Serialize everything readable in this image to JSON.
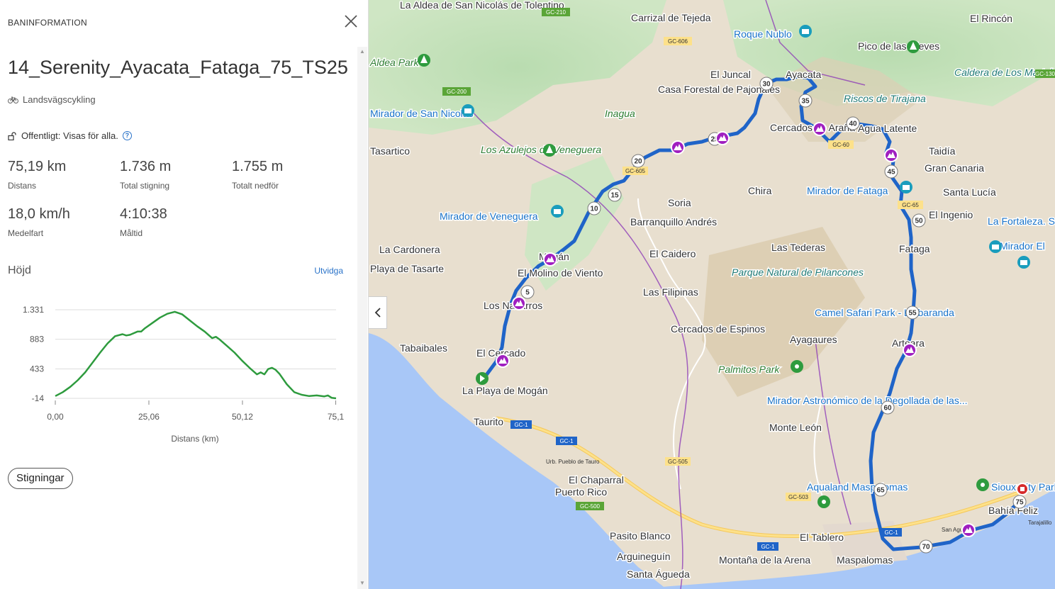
{
  "panel": {
    "header": "BANINFORMATION",
    "route_name": "14_Serenity_Ayacata_Fataga_75_TS25",
    "sport": "Landsvägscykling",
    "visibility": "Offentligt: Visas för alla.",
    "stats": [
      {
        "value": "75,19 km",
        "label": "Distans"
      },
      {
        "value": "1.736 m",
        "label": "Total stigning"
      },
      {
        "value": "1.755 m",
        "label": "Totalt nedför"
      },
      {
        "value": "18,0 km/h",
        "label": "Medelfart"
      },
      {
        "value": "4:10:38",
        "label": "Måltid"
      }
    ],
    "elevation_title": "Höjd",
    "expand_link": "Utvidga",
    "climbs_button": "Stigningar"
  },
  "chart_data": {
    "type": "line",
    "xlabel": "Distans (km)",
    "ylabel": "",
    "x_ticks": [
      "0,00",
      "25,06",
      "50,12",
      "75,1"
    ],
    "y_ticks": [
      "1.331",
      "883",
      "433",
      "-14"
    ],
    "xlim": [
      0,
      75.19
    ],
    "ylim": [
      -14,
      1331
    ],
    "grid": true,
    "color": "#2e9b3e",
    "x": [
      0,
      2,
      4,
      6,
      8,
      10,
      12,
      14,
      16,
      18,
      19,
      20,
      22,
      23,
      24,
      26,
      28,
      30,
      32,
      33,
      34,
      36,
      38,
      40,
      42,
      43,
      44,
      46,
      48,
      50,
      52,
      54,
      55,
      56,
      57,
      58,
      59,
      60,
      62,
      64,
      66,
      68,
      70,
      72,
      73,
      74,
      75.19
    ],
    "y": [
      20,
      80,
      160,
      260,
      380,
      530,
      680,
      820,
      930,
      960,
      940,
      950,
      1000,
      1000,
      1050,
      1130,
      1210,
      1270,
      1300,
      1280,
      1260,
      1170,
      1080,
      1000,
      900,
      920,
      880,
      780,
      680,
      560,
      450,
      350,
      380,
      350,
      430,
      450,
      420,
      360,
      200,
      80,
      40,
      20,
      30,
      15,
      30,
      -5,
      -14
    ]
  },
  "map": {
    "place_labels": [
      "La Aldea de San Nicolás de Tolentino",
      "Carrizal de Tejeda",
      "Roque Nublo",
      "Pico de las Nieves",
      "El Rincón",
      "Caldera de Los Marteles",
      "El Juncal",
      "Ayacata",
      "Casa Forestal de Pajonales",
      "Inagua",
      "Riscos de Tirajana",
      "Cercados de Araña",
      "Agua Latente",
      "Taidía",
      "Gran Canaria",
      "Santa Lucía",
      "La Fortaleza. Santa Lucía de Tirajana",
      "Mirador El",
      "Mirador de San Nicolás",
      "Los Azulejos de Veneguera",
      "Mirador de Veneguera",
      "Chira",
      "Mirador de Fataga",
      "El Ingenio",
      "Soria",
      "Barranquillo Andrés",
      "El Caidero",
      "Las Tederas",
      "Fataga",
      "La Cardonera",
      "Playa de Tasarte",
      "Mogán",
      "El Molino de Viento",
      "Los Navarros",
      "Las Filipinas",
      "Parque Natural de Pilancones",
      "Camel Safari Park - La baranda",
      "Cercados de Espinos",
      "Ayagaures",
      "Arteara",
      "Tabaibales",
      "El Cercado",
      "La Playa de Mogán",
      "Palmitos Park",
      "Mirador Astronómico de la Degollada de las...",
      "Monte León",
      "Taurito",
      "Urb. Pueblo de Tauro",
      "El Chaparral",
      "Puerto Rico",
      "Aqualand Maspalomas",
      "Sioux City Park",
      "Bahía Feliz",
      "San Agustín",
      "Tarajalillo",
      "El Tablero",
      "Maspalomas",
      "Pasito Blanco",
      "Arguineguín",
      "Montaña de la Arena",
      "Santa Águeda",
      "Veneguera",
      "Tasartico",
      "Aldea Park"
    ],
    "road_labels": [
      "GC-210",
      "GC-606",
      "GC-200",
      "GC-605",
      "GC-60",
      "GC-505",
      "GC-503",
      "GC-500",
      "GC-1",
      "GC-65",
      "GC-130"
    ],
    "km_markers": [
      "5",
      "10",
      "15",
      "20",
      "25",
      "30",
      "35",
      "40",
      "45",
      "50",
      "55",
      "60",
      "65",
      "70",
      "75"
    ],
    "route_color": "#1f64c8",
    "climb_marker_color": "#a01fc0"
  }
}
